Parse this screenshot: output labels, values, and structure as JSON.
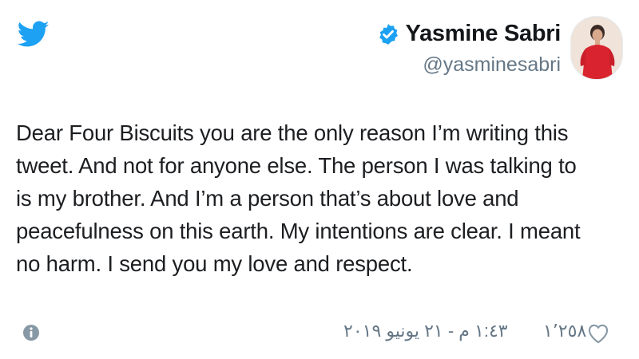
{
  "tweet": {
    "author": {
      "display_name": "Yasmine Sabri",
      "handle": "@yasminesabri",
      "verified": true
    },
    "text_lines": [
      "Dear Four Biscuits you are the only reason I’m writing this",
      "tweet. And not for anyone else. The person I was talking to",
      "is my brother. And I’m a person that’s about love and",
      "peacefulness on this earth. My intentions are clear. I meant",
      "no harm. I send you my love and respect."
    ],
    "timestamp": "١:٤٣ م - ٢١ يونيو ٢٠١٩",
    "like_count": "١٬٢٥٨"
  },
  "colors": {
    "twitter_blue": "#1da1f2",
    "text": "#14171a",
    "muted": "#657786",
    "avatar_dress": "#d9232e"
  },
  "icons": [
    "twitter-bird-icon",
    "verified-badge-icon",
    "info-icon",
    "heart-icon"
  ]
}
